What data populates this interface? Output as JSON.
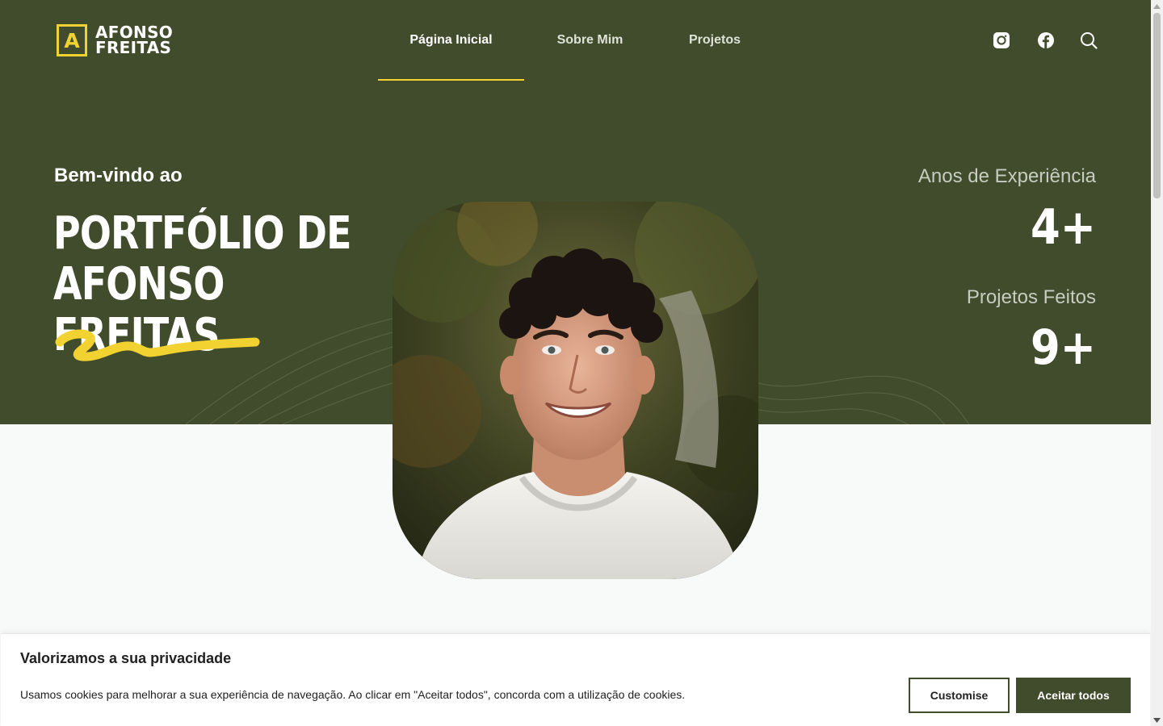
{
  "colors": {
    "hero_background": "#404c2c",
    "accent_yellow": "#f2d230",
    "page_background": "#f8fafa",
    "text_white": "#ffffff",
    "muted_label": "#c8ccc0"
  },
  "header": {
    "logo": {
      "mark": "A",
      "line1": "AFONSO",
      "line2": "FREITAS"
    },
    "nav": [
      {
        "label": "Página Inicial",
        "active": true
      },
      {
        "label": "Sobre Mim",
        "active": false
      },
      {
        "label": "Projetos",
        "active": false
      }
    ],
    "icons": [
      "instagram-icon",
      "facebook-icon",
      "search-icon"
    ]
  },
  "hero": {
    "welcome": "Bem-vindo ao",
    "title_line1": "PORTFÓLIO DE",
    "title_line2": "AFONSO FREITAS",
    "stats": [
      {
        "label": "Anos de Experiência",
        "value": "4+"
      },
      {
        "label": "Projetos Feitos",
        "value": "9+"
      }
    ]
  },
  "cookie_banner": {
    "title": "Valorizamos a sua privacidade",
    "text": "Usamos cookies para melhorar a sua experiência de navegação. Ao clicar em \"Aceitar todos\", concorda com a utilização de cookies.",
    "customise_label": "Customise",
    "accept_label": "Aceitar todos"
  }
}
